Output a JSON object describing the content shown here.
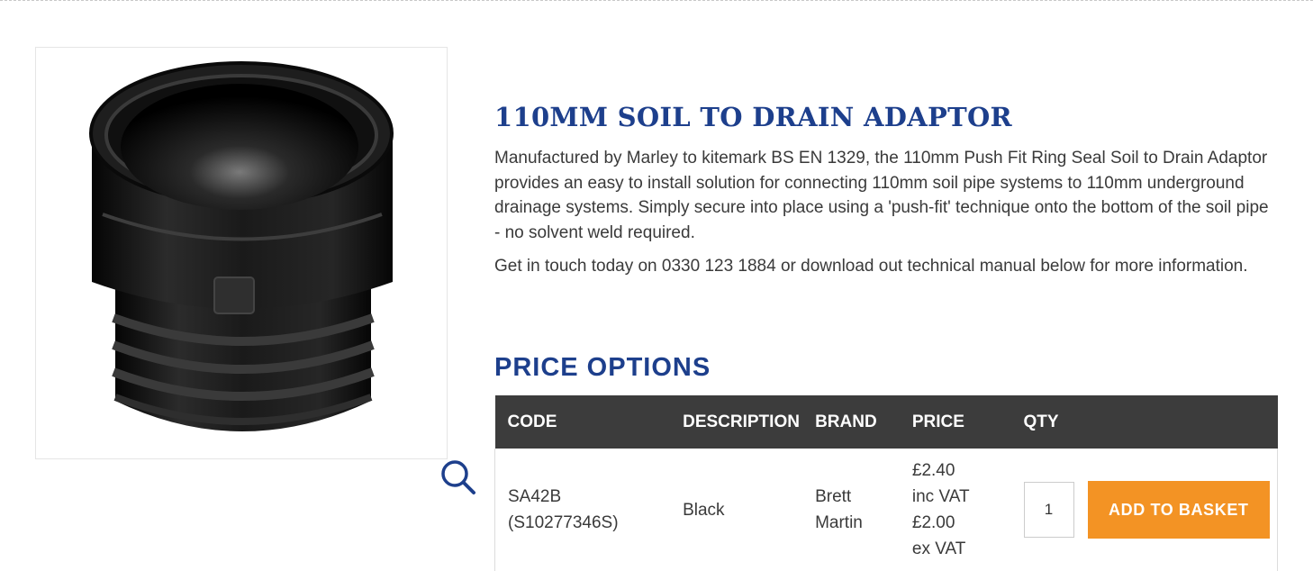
{
  "product": {
    "title": "110MM SOIL TO DRAIN ADAPTOR",
    "description": "Manufactured by Marley to kitemark BS EN 1329, the 110mm Push Fit Ring Seal Soil to Drain Adaptor provides an easy to install solution for connecting 110mm soil pipe systems to 110mm underground drainage systems. Simply secure into place using a 'push-fit' technique onto the bottom of the soil pipe - no solvent weld required.",
    "contact": "Get in touch today on 0330 123 1884 or download out technical manual below for more information.",
    "image_icon": "zoom-icon"
  },
  "price_options": {
    "heading": "PRICE OPTIONS",
    "columns": {
      "code": "CODE",
      "description": "DESCRIPTION",
      "brand": "BRAND",
      "price": "PRICE",
      "qty": "QTY"
    },
    "rows": [
      {
        "code": "SA42B",
        "code_alt": "(S10277346S)",
        "description": "Black",
        "brand_line1": "Brett",
        "brand_line2": "Martin",
        "price_inc": "£2.40",
        "inc_label": "inc VAT",
        "price_ex": "£2.00",
        "ex_label": "ex VAT",
        "qty": "1",
        "button_label": "ADD TO BASKET"
      }
    ]
  },
  "colors": {
    "heading_blue": "#1d3f8c",
    "table_header_bg": "#3c3c3c",
    "button_orange": "#f39324"
  }
}
